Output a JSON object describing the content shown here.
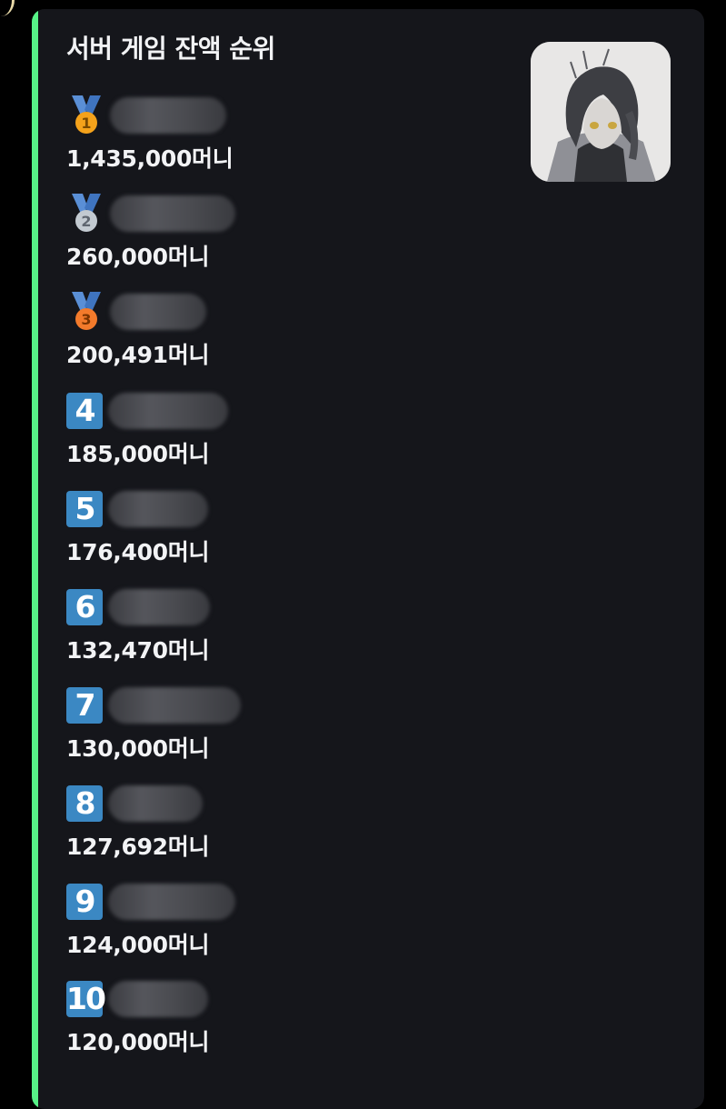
{
  "embed": {
    "accent_color": "#57f287",
    "title": "서버 게임 잔액 순위",
    "thumbnail_icon": "avatar-thumbnail"
  },
  "ranking": [
    {
      "rank": "1",
      "badge_type": "gold-medal",
      "amount": "1,435,000머니"
    },
    {
      "rank": "2",
      "badge_type": "silver-medal",
      "amount": "260,000머니"
    },
    {
      "rank": "3",
      "badge_type": "bronze-medal",
      "amount": "200,491머니"
    },
    {
      "rank": "4",
      "badge_type": "number",
      "amount": "185,000머니"
    },
    {
      "rank": "5",
      "badge_type": "number",
      "amount": "176,400머니"
    },
    {
      "rank": "6",
      "badge_type": "number",
      "amount": "132,470머니"
    },
    {
      "rank": "7",
      "badge_type": "number",
      "amount": "130,000머니"
    },
    {
      "rank": "8",
      "badge_type": "number",
      "amount": "127,692머니"
    },
    {
      "rank": "9",
      "badge_type": "number",
      "amount": "124,000머니"
    },
    {
      "rank": "10",
      "badge_type": "number",
      "amount": "120,000머니"
    }
  ],
  "colors": {
    "background": "#000000",
    "embed_background": "#15161b",
    "text": "#f2f3f5",
    "number_badge": "#3b88c3",
    "gold": "#f4a21b",
    "silver": "#c3cad1",
    "bronze": "#f37a2b",
    "ribbon": "#5a8fd6"
  }
}
